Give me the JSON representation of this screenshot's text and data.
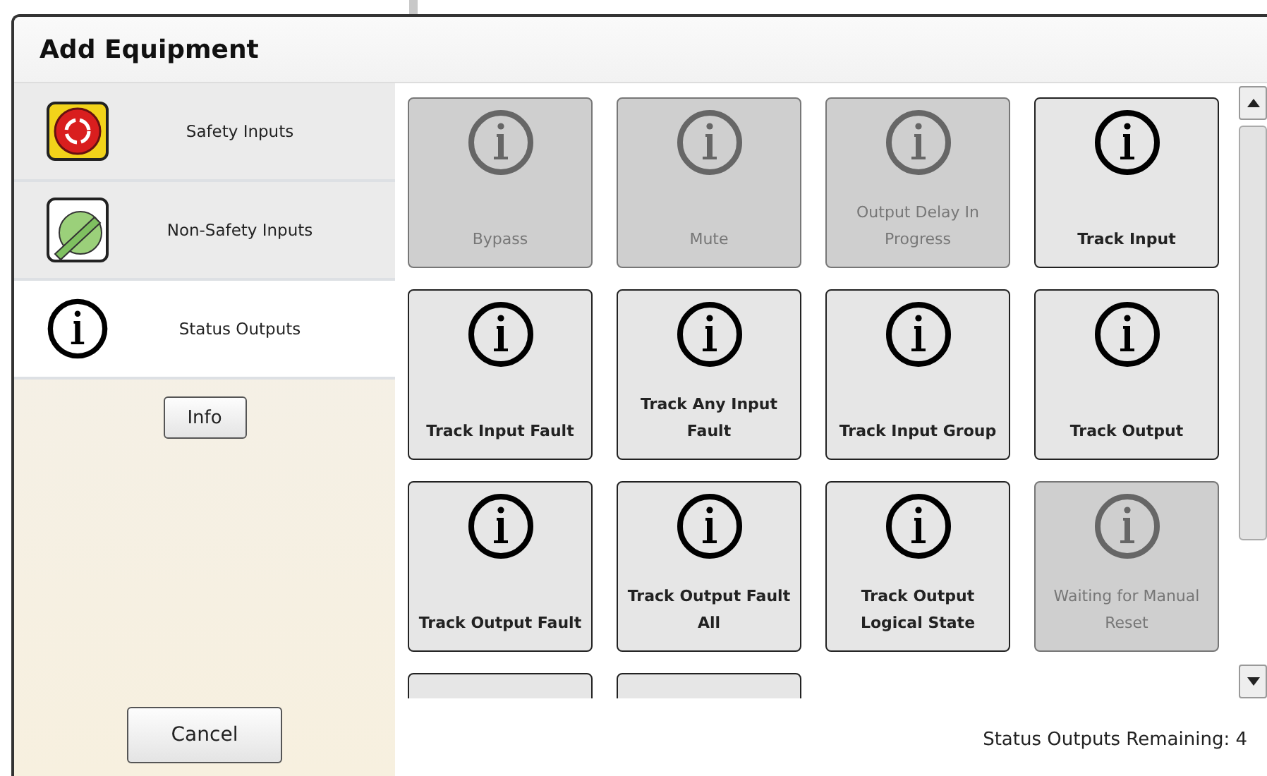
{
  "window": {
    "title": "Add Equipment"
  },
  "sidebar": {
    "items": [
      {
        "label": "Safety Inputs",
        "kind": "stop",
        "selected": false
      },
      {
        "label": "Non-Safety Inputs",
        "kind": "switch",
        "selected": false
      },
      {
        "label": "Status Outputs",
        "kind": "info",
        "selected": true
      }
    ],
    "info_button": "Info",
    "cancel_button": "Cancel"
  },
  "tiles": [
    {
      "label": "Bypass",
      "disabled": true
    },
    {
      "label": "Mute",
      "disabled": true
    },
    {
      "label": "Output Delay In Progress",
      "disabled": true
    },
    {
      "label": "Track Input",
      "disabled": false
    },
    {
      "label": "Track Input Fault",
      "disabled": false
    },
    {
      "label": "Track Any Input Fault",
      "disabled": false
    },
    {
      "label": "Track Input Group",
      "disabled": false
    },
    {
      "label": "Track Output",
      "disabled": false
    },
    {
      "label": "Track Output Fault",
      "disabled": false
    },
    {
      "label": "Track Output Fault All",
      "disabled": false
    },
    {
      "label": "Track Output Logical State",
      "disabled": false
    },
    {
      "label": "Waiting for Manual Reset",
      "disabled": true
    }
  ],
  "status_bar": "Status Outputs Remaining: 4"
}
